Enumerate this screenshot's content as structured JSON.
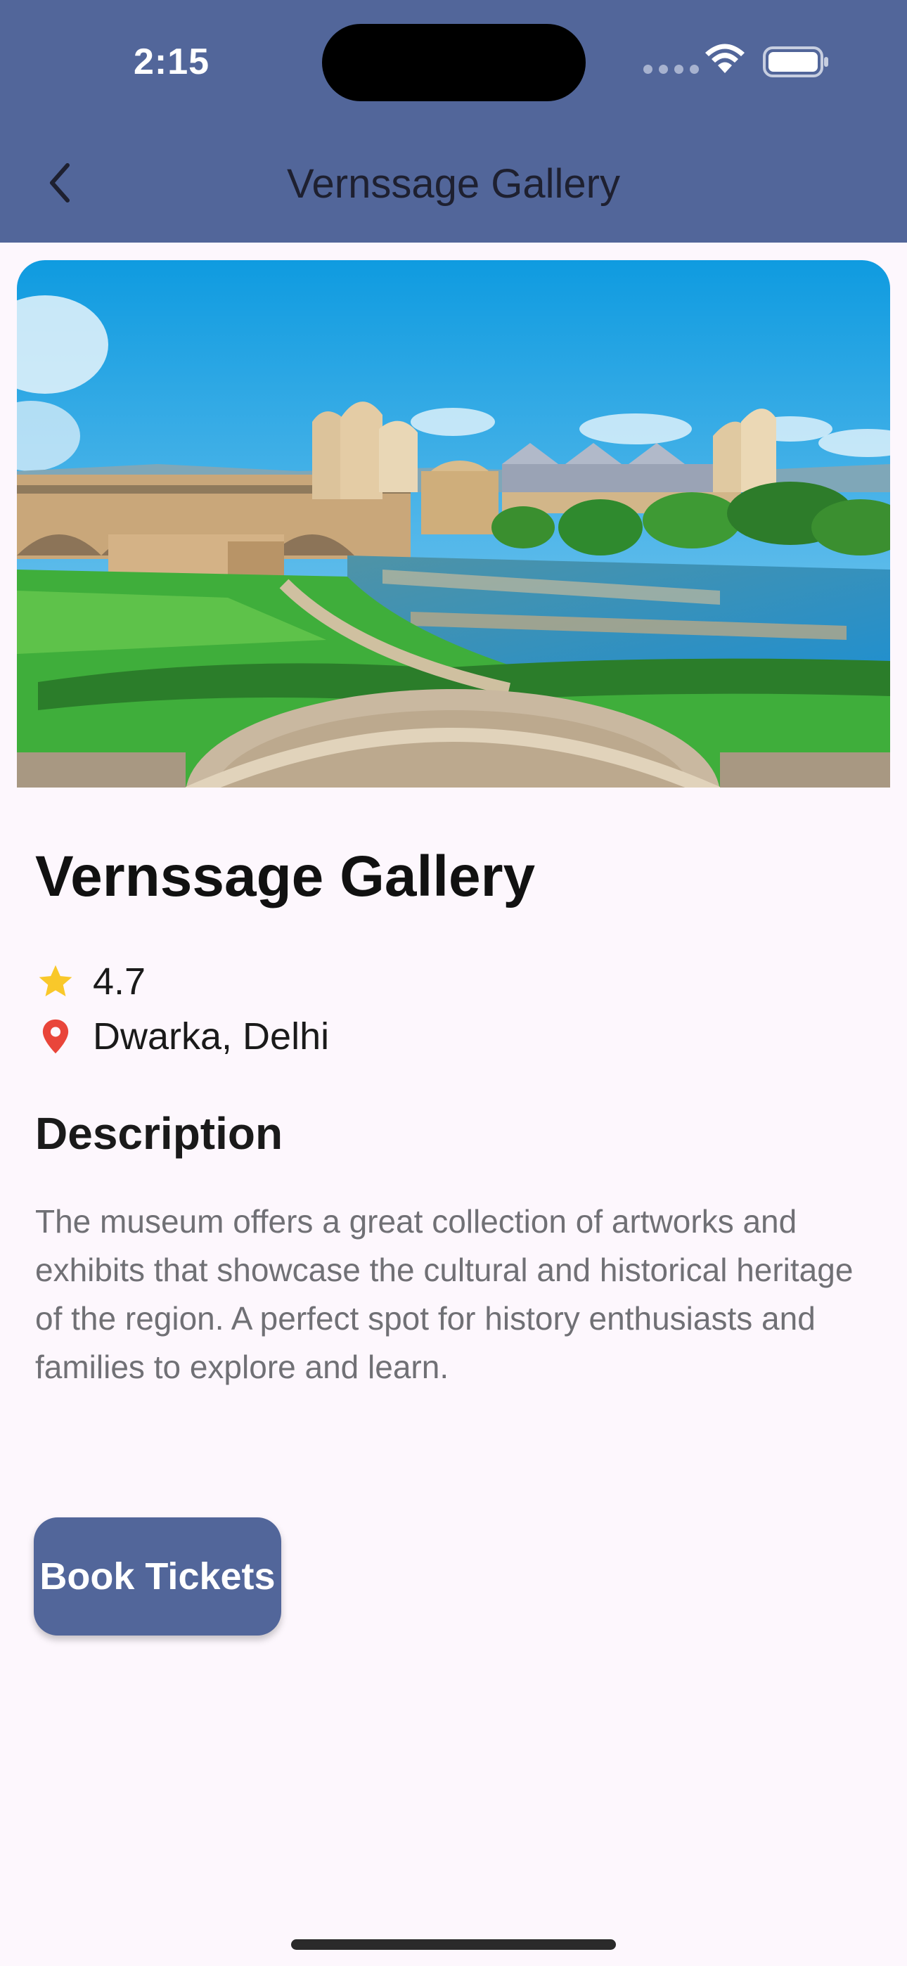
{
  "status_bar": {
    "time": "2:15"
  },
  "nav": {
    "title": "Vernssage Gallery",
    "back_icon": "chevron-left-icon"
  },
  "place": {
    "name": "Vernssage Gallery",
    "rating": "4.7",
    "location": "Dwarka, Delhi",
    "rating_icon": "star-icon",
    "location_icon": "location-pin-icon"
  },
  "description": {
    "heading": "Description",
    "body": "The museum offers a great collection of artworks and exhibits that showcase the cultural and historical heritage of the region. A perfect spot for history enthusiasts and families to explore and learn."
  },
  "actions": {
    "book_label": "Book Tickets"
  },
  "colors": {
    "primary": "#52669a",
    "background": "#fdf7fd",
    "star": "#f9c82a",
    "pin": "#e9453a"
  }
}
